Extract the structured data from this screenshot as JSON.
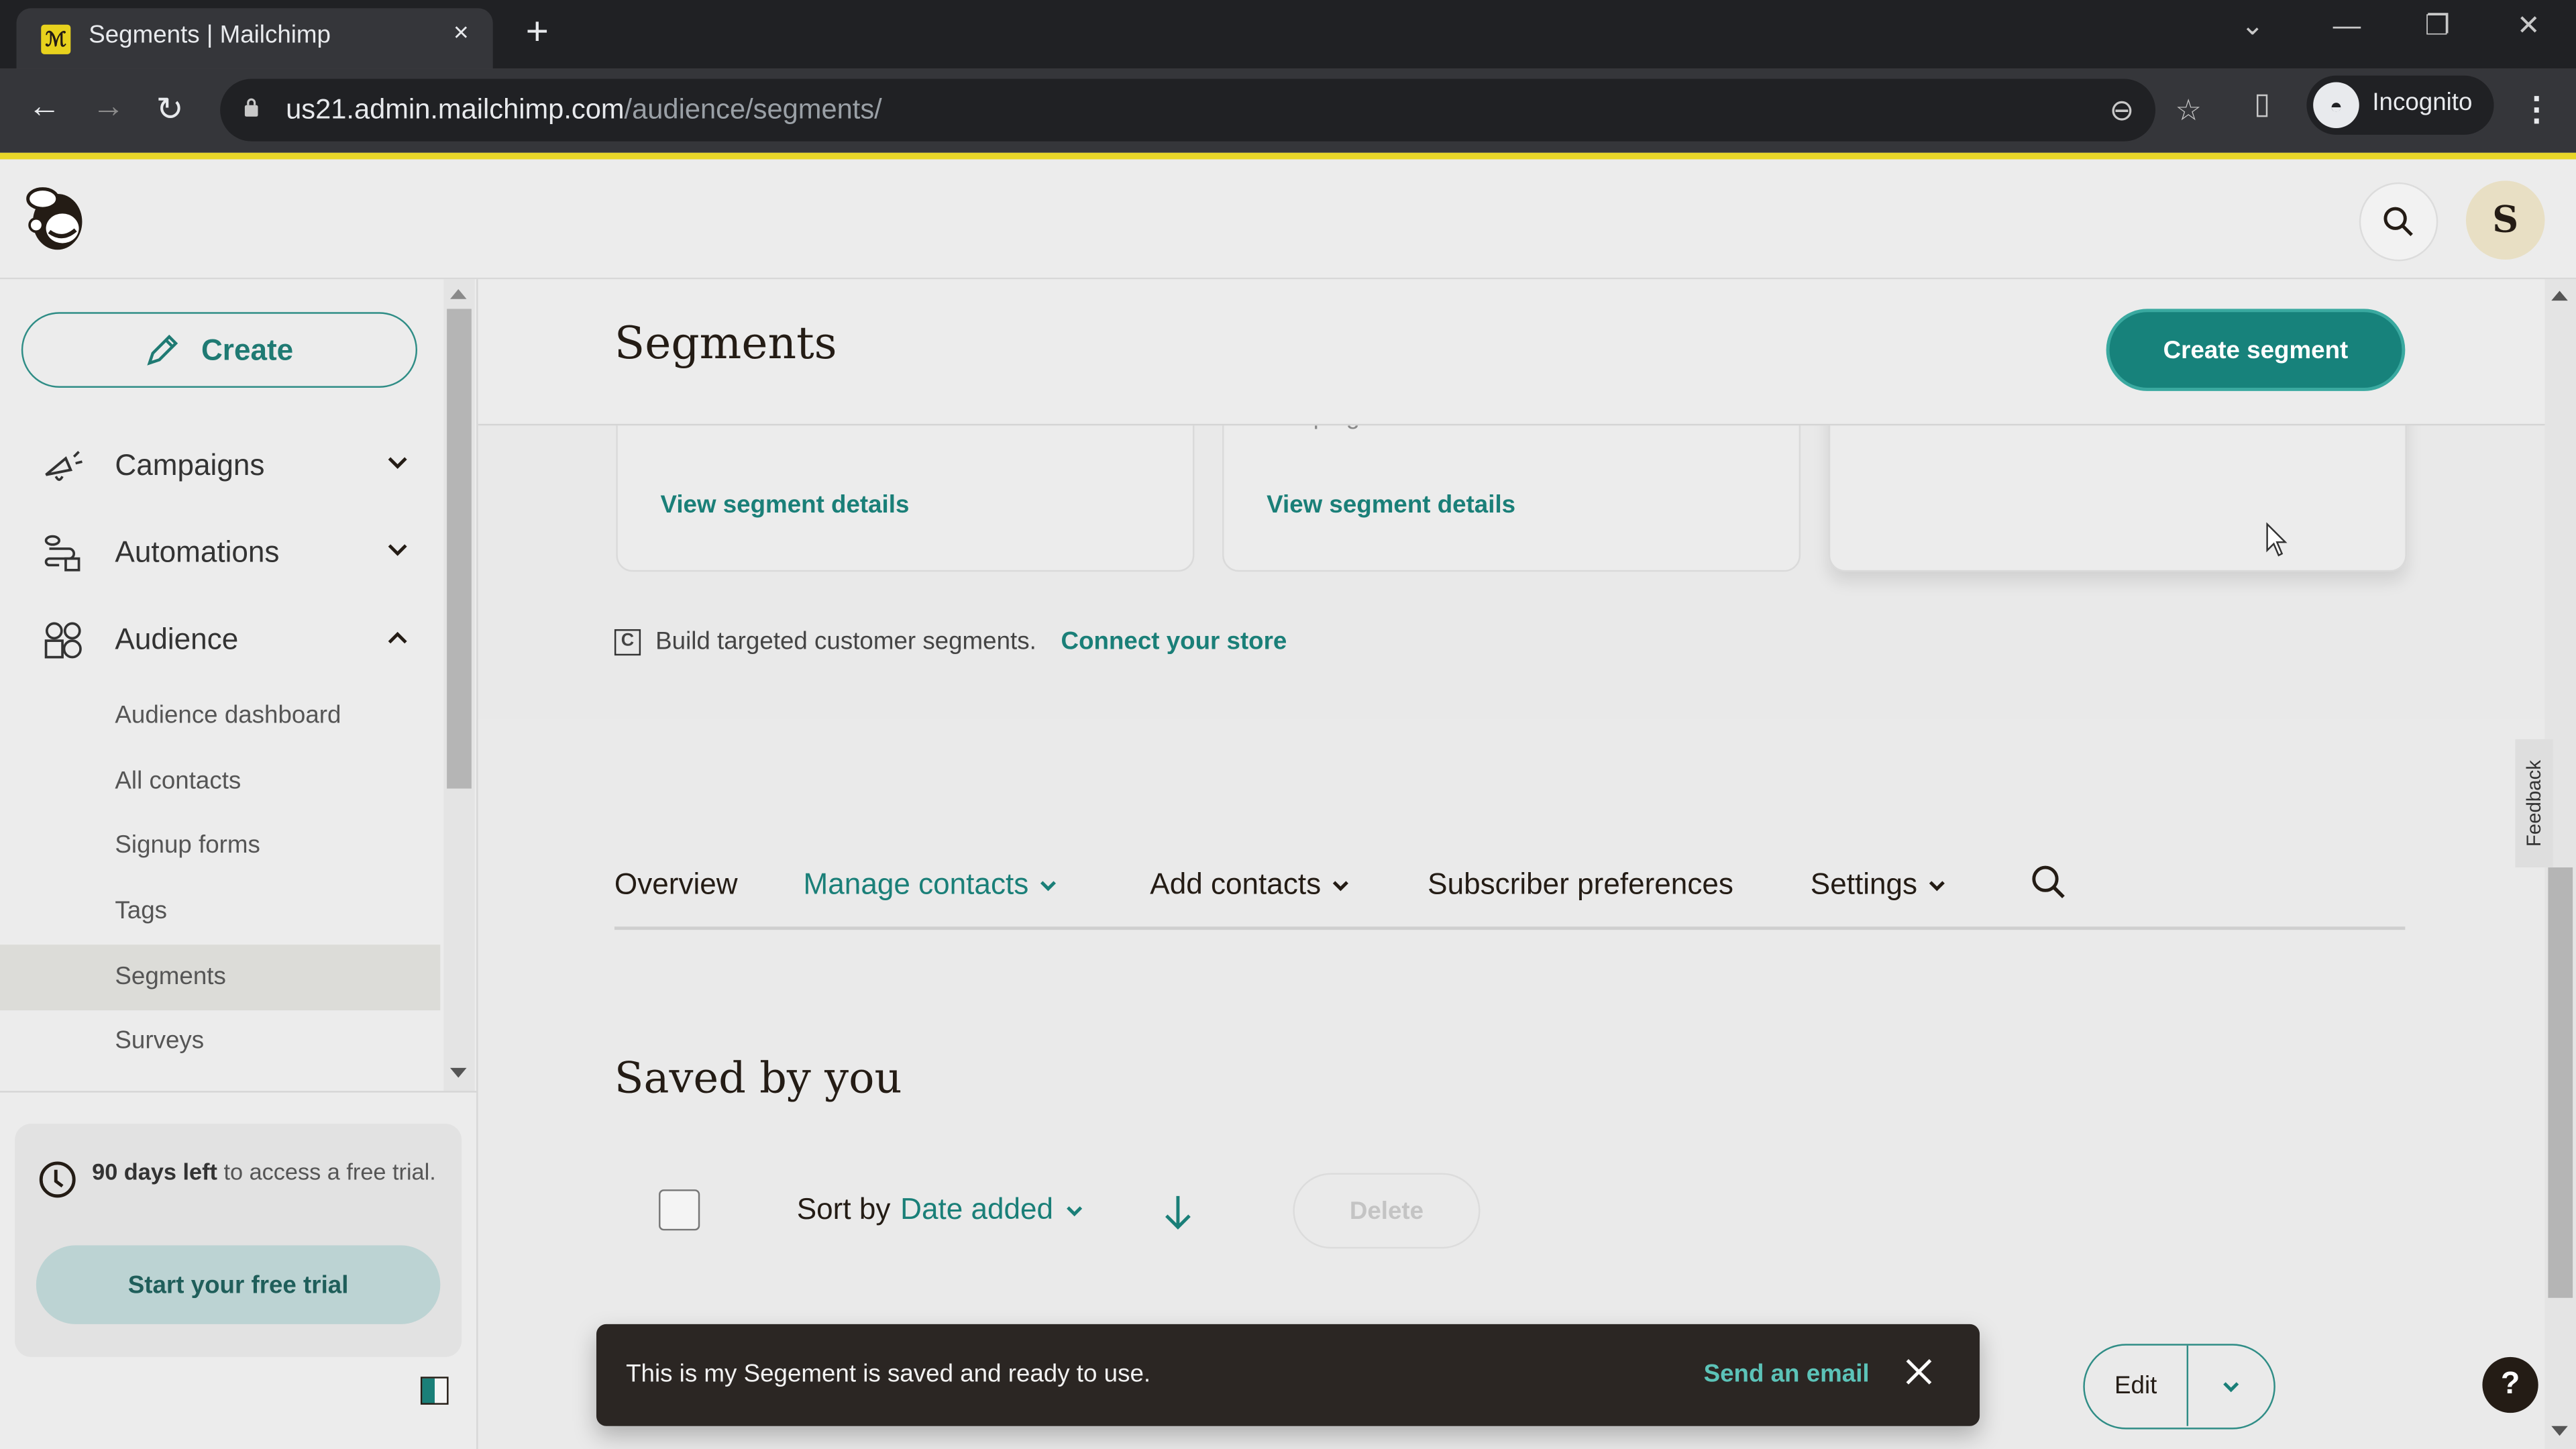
{
  "browser": {
    "tab_title": "Segments | Mailchimp",
    "tab_close": "×",
    "new_tab": "+",
    "url_host": "us21.admin.mailchimp.com",
    "url_path": "/audience/segments/",
    "profile_label": "Incognito"
  },
  "header": {
    "avatar_initial": "S"
  },
  "sidebar": {
    "create_label": "Create",
    "nav": [
      {
        "label": "Campaigns",
        "icon": "megaphone-icon",
        "expanded": false
      },
      {
        "label": "Automations",
        "icon": "workflow-icon",
        "expanded": false
      },
      {
        "label": "Audience",
        "icon": "audience-icon",
        "expanded": true
      }
    ],
    "audience_items": [
      {
        "label": "Audience dashboard",
        "active": false
      },
      {
        "label": "All contacts",
        "active": false
      },
      {
        "label": "Signup forms",
        "active": false
      },
      {
        "label": "Tags",
        "active": false
      },
      {
        "label": "Segments",
        "active": true
      },
      {
        "label": "Surveys",
        "active": false
      }
    ],
    "trial": {
      "days_bold": "90 days left",
      "rest": " to access a free trial.",
      "button": "Start your free trial"
    }
  },
  "main": {
    "title": "Segments",
    "create_segment_label": "Create segment",
    "cards": [
      {
        "cut_text": "",
        "link": "View segment details"
      },
      {
        "cut_text": "campaigns.",
        "link": "View segment details"
      },
      {
        "cut_text": "",
        "link": ""
      }
    ],
    "store_prompt": {
      "icon_text": "C",
      "text": "Build targeted customer segments.",
      "link": "Connect your store"
    },
    "tabs": [
      {
        "label": "Overview",
        "dropdown": false,
        "active": false
      },
      {
        "label": "Manage contacts",
        "dropdown": true,
        "active": true
      },
      {
        "label": "Add contacts",
        "dropdown": true,
        "active": false
      },
      {
        "label": "Subscriber preferences",
        "dropdown": false,
        "active": false
      },
      {
        "label": "Settings",
        "dropdown": true,
        "active": false
      }
    ],
    "saved_title": "Saved by you",
    "sort_prefix": "Sort by",
    "sort_value": "Date added",
    "delete_label": "Delete",
    "edit_label": "Edit"
  },
  "toast": {
    "message": "This is my Segement is saved and ready to use.",
    "action": "Send an email"
  },
  "feedback_label": "Feedback",
  "help_label": "?",
  "colors": {
    "brand_teal": "#17827b",
    "link_teal": "#1a7f78",
    "accent_yellow": "#e8d628",
    "toast_bg": "#2b2623"
  }
}
